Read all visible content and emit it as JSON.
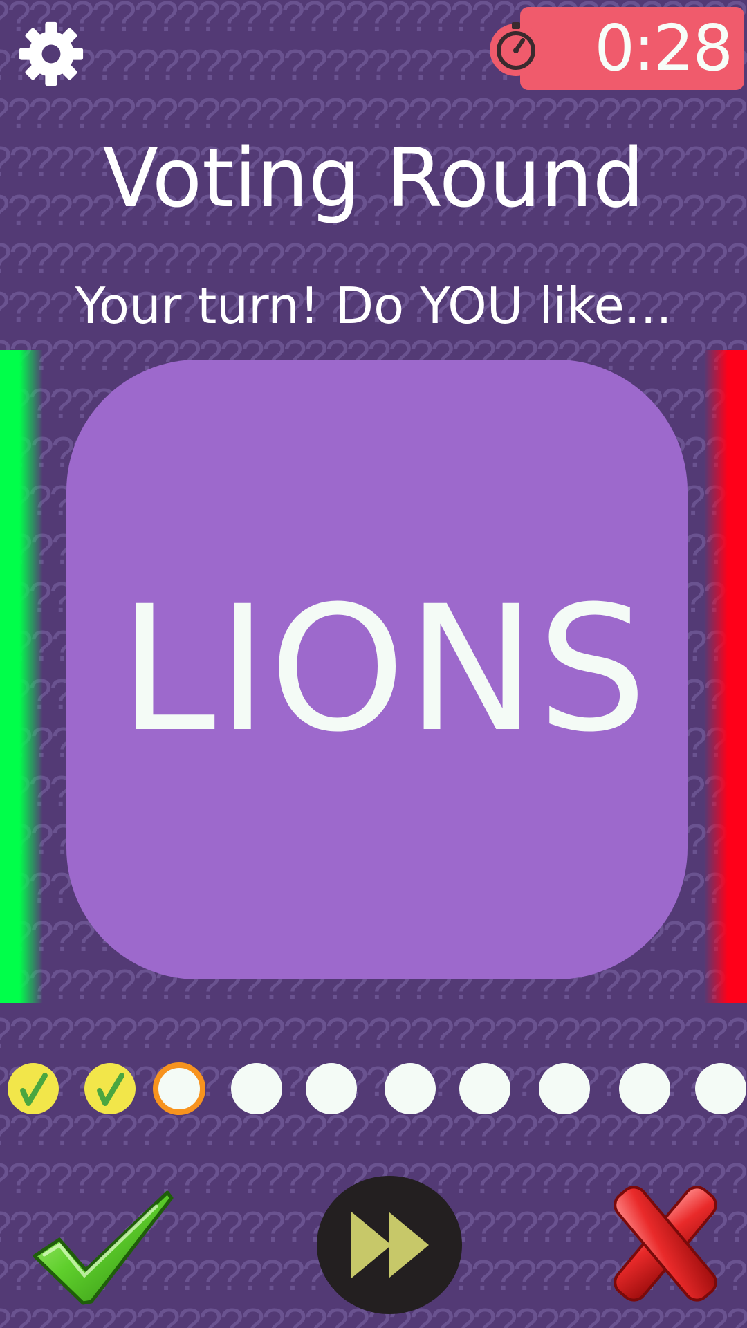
{
  "header": {
    "settings_icon": "gear-icon",
    "timer": {
      "icon": "stopwatch-icon",
      "value": "0:28",
      "color": "#f05b6c"
    }
  },
  "title": "Voting Round",
  "subtitle": "Your turn! Do YOU like...",
  "card": {
    "word": "LIONS",
    "color": "#9d69cc"
  },
  "side_indicators": {
    "like_color": "#00ff4a",
    "dislike_color": "#ff0019"
  },
  "progress": {
    "total": 10,
    "completed": 2,
    "current": 3,
    "states": [
      "done",
      "done",
      "current",
      "pending",
      "pending",
      "pending",
      "pending",
      "pending",
      "pending",
      "pending"
    ]
  },
  "actions": {
    "yes_icon": "checkmark-icon",
    "skip_icon": "fast-forward-icon",
    "no_icon": "x-cross-icon"
  },
  "colors": {
    "background": "#533a75",
    "done_dot": "#f2e64a",
    "check_mark": "#4aa640",
    "current_ring": "#f7931e",
    "pending_dot": "#f4fbf6"
  }
}
